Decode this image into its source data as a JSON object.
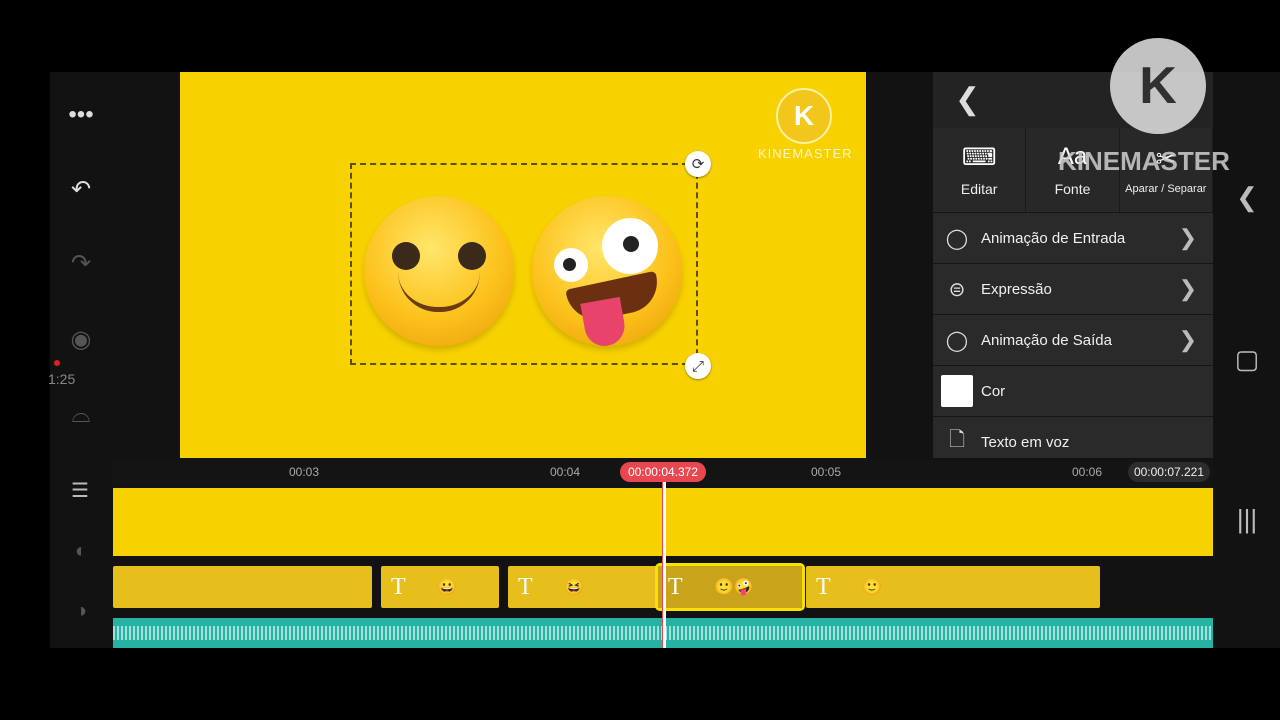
{
  "toolbar": {
    "more_icon": "more-horizontal-icon",
    "undo_icon": "undo-icon",
    "redo_icon": "redo-icon",
    "capture_icon": "capture-icon",
    "curve_icon": "curve-icon",
    "time": "1:25"
  },
  "preview": {
    "watermark_letter": "K",
    "watermark_text": "KINEMASTER",
    "rotate_icon": "rotate-icon",
    "resize_icon": "resize-icon"
  },
  "panel": {
    "back_icon": "chevron-left-icon",
    "tabs": [
      {
        "label": "Editar",
        "icon": "keyboard-icon"
      },
      {
        "label": "Fonte",
        "icon_text": "Aa"
      },
      {
        "label": "Aparar / Separar",
        "icon": "scissors-icon"
      }
    ],
    "menu": [
      {
        "label": "Animação de Entrada",
        "icon": "circle-icon"
      },
      {
        "label": "Expressão",
        "icon": "expression-icon"
      },
      {
        "label": "Animação de Saída",
        "icon": "circle-icon"
      },
      {
        "label": "Cor",
        "color": "#ffffff"
      },
      {
        "label": "Texto em voz",
        "icon": "document-icon"
      }
    ],
    "brand_overlay": "KINEMASTER",
    "logo_letter": "K"
  },
  "timeline": {
    "ticks": [
      "00:03",
      "00:04",
      "00:05",
      "00:06"
    ],
    "playhead": "00:00:04.372",
    "total": "00:00:07.221"
  },
  "colors": {
    "accent": "#f7d100",
    "playhead": "#e9474f",
    "audio": "#26b3a4"
  }
}
